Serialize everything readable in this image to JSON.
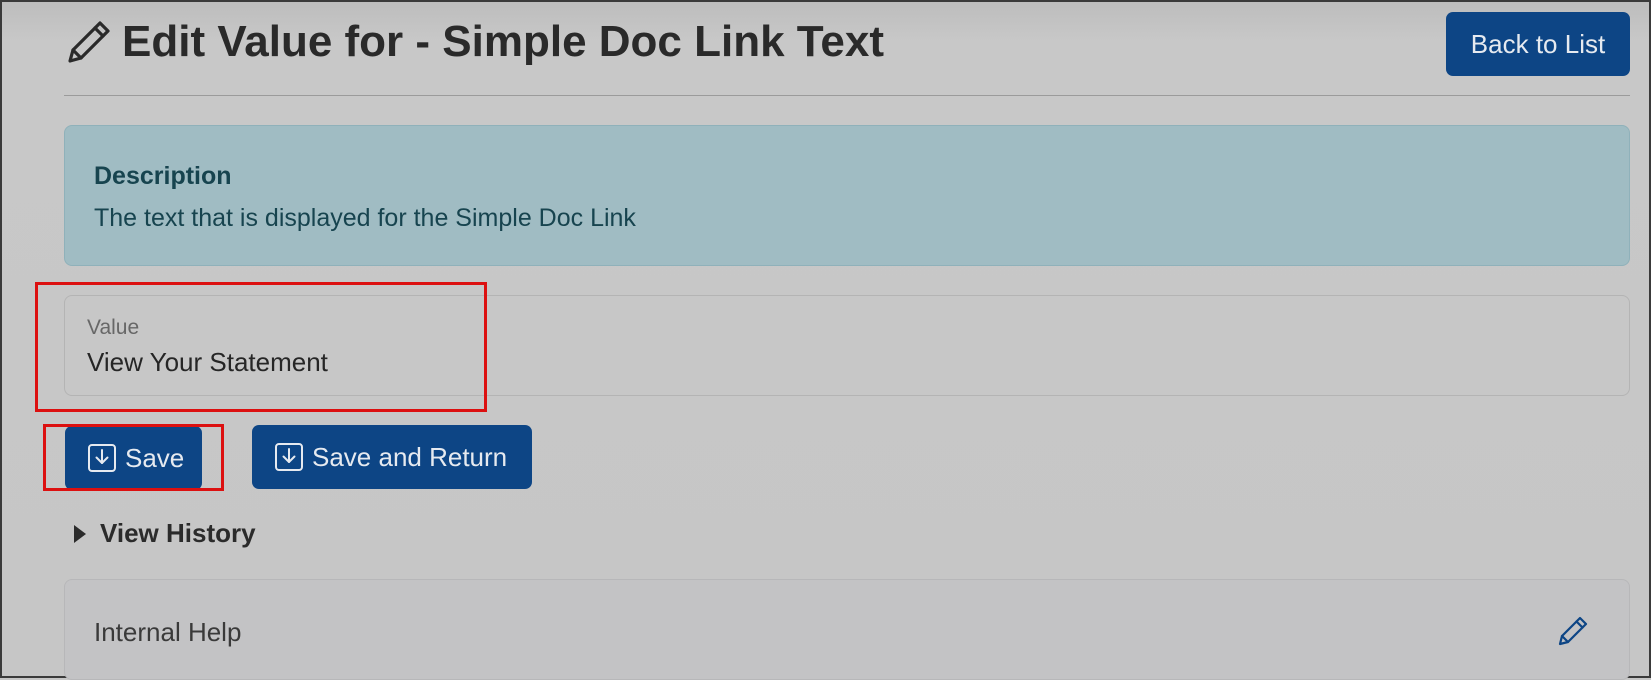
{
  "header": {
    "title": "Edit Value for - Simple Doc Link Text",
    "title_icon": "pencil-icon",
    "back_label": "Back to List"
  },
  "description": {
    "heading": "Description",
    "text": "The text that is displayed for the Simple Doc Link"
  },
  "value_field": {
    "label": "Value",
    "value": "View Your Statement"
  },
  "actions": {
    "save_label": "Save",
    "save_return_label": "Save and Return",
    "save_icon": "save-download-icon"
  },
  "history": {
    "label": "View History",
    "icon": "caret-right-icon"
  },
  "internal_help": {
    "label": "Internal Help",
    "edit_icon": "pencil-icon"
  },
  "colors": {
    "primary": "#0d4585",
    "highlight": "#dc1010",
    "info_bg": "#a0bcc3",
    "info_text": "#17444f"
  }
}
